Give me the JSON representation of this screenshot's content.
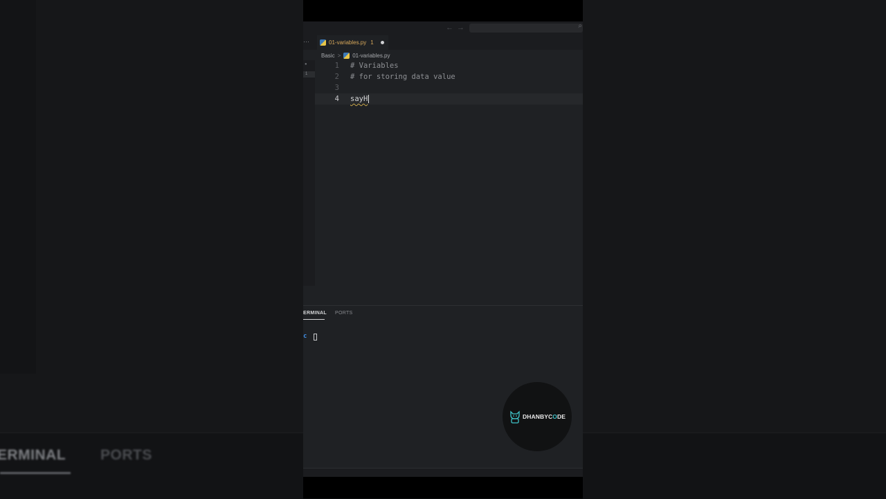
{
  "background": {
    "terminal_tab": "ERMINAL",
    "ports_tab": "PORTS"
  },
  "tab": {
    "name": "01-variables.py",
    "problems_count": "1",
    "modified": true
  },
  "breadcrumb": {
    "folder": "Basic",
    "separator": ">",
    "file": "01-variables.py"
  },
  "gutter_markers": {
    "marker_1": "1"
  },
  "editor": {
    "lines": [
      {
        "number": "1",
        "text": "# Variables"
      },
      {
        "number": "2",
        "text": "# for storing data value"
      },
      {
        "number": "3",
        "text": ""
      },
      {
        "number": "4",
        "text": "sayH"
      }
    ],
    "current_line": "4"
  },
  "panel": {
    "terminal_tab": "ERMINAL",
    "ports_tab": "PORTS",
    "prompt": "c"
  },
  "watermark": {
    "text_before": "DHANBYC",
    "text_o": "O",
    "text_after": "DE"
  },
  "colors": {
    "accent_blue": "#3f8ee6",
    "tab_modified": "#d9a95b",
    "editor_bg": "#1f2124",
    "watermark_accent": "#3fc3c8"
  }
}
